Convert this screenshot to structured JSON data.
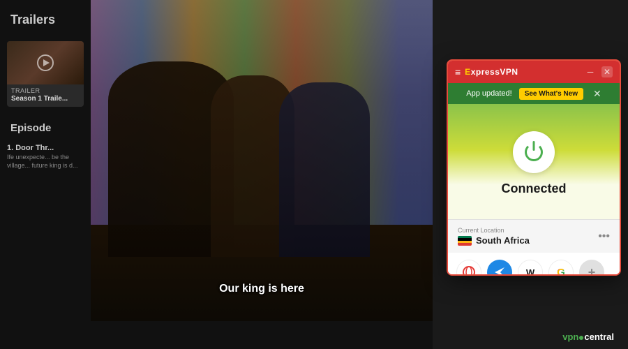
{
  "sidebar": {
    "trailers_title": "Trailers",
    "trailer": {
      "label": "TRAILER",
      "name": "Season 1 Traile..."
    },
    "episodes_title": "Episode",
    "episodes": [
      {
        "number": "1. Door Thr...",
        "desc": "Ife unexpecte... be the village... future king is d..."
      }
    ]
  },
  "video": {
    "subtitle": "Our king is here"
  },
  "vpn_window": {
    "title": "ExpressVPN",
    "hamburger": "≡",
    "minimize": "─",
    "close": "✕",
    "update_text": "App updated!",
    "see_whats_new": "See What's New",
    "update_close": "✕",
    "power_state": "Connected",
    "location_label": "Current Location",
    "location_name": "South Africa",
    "more_options": "•••",
    "shortcuts": [
      {
        "label": "O",
        "type": "opera"
      },
      {
        "label": "✉",
        "type": "send"
      },
      {
        "label": "W",
        "type": "wiki"
      },
      {
        "label": "G",
        "type": "google"
      },
      {
        "label": "+",
        "type": "add"
      }
    ]
  },
  "watermark": {
    "vpn": "vpn",
    "central": "central"
  }
}
